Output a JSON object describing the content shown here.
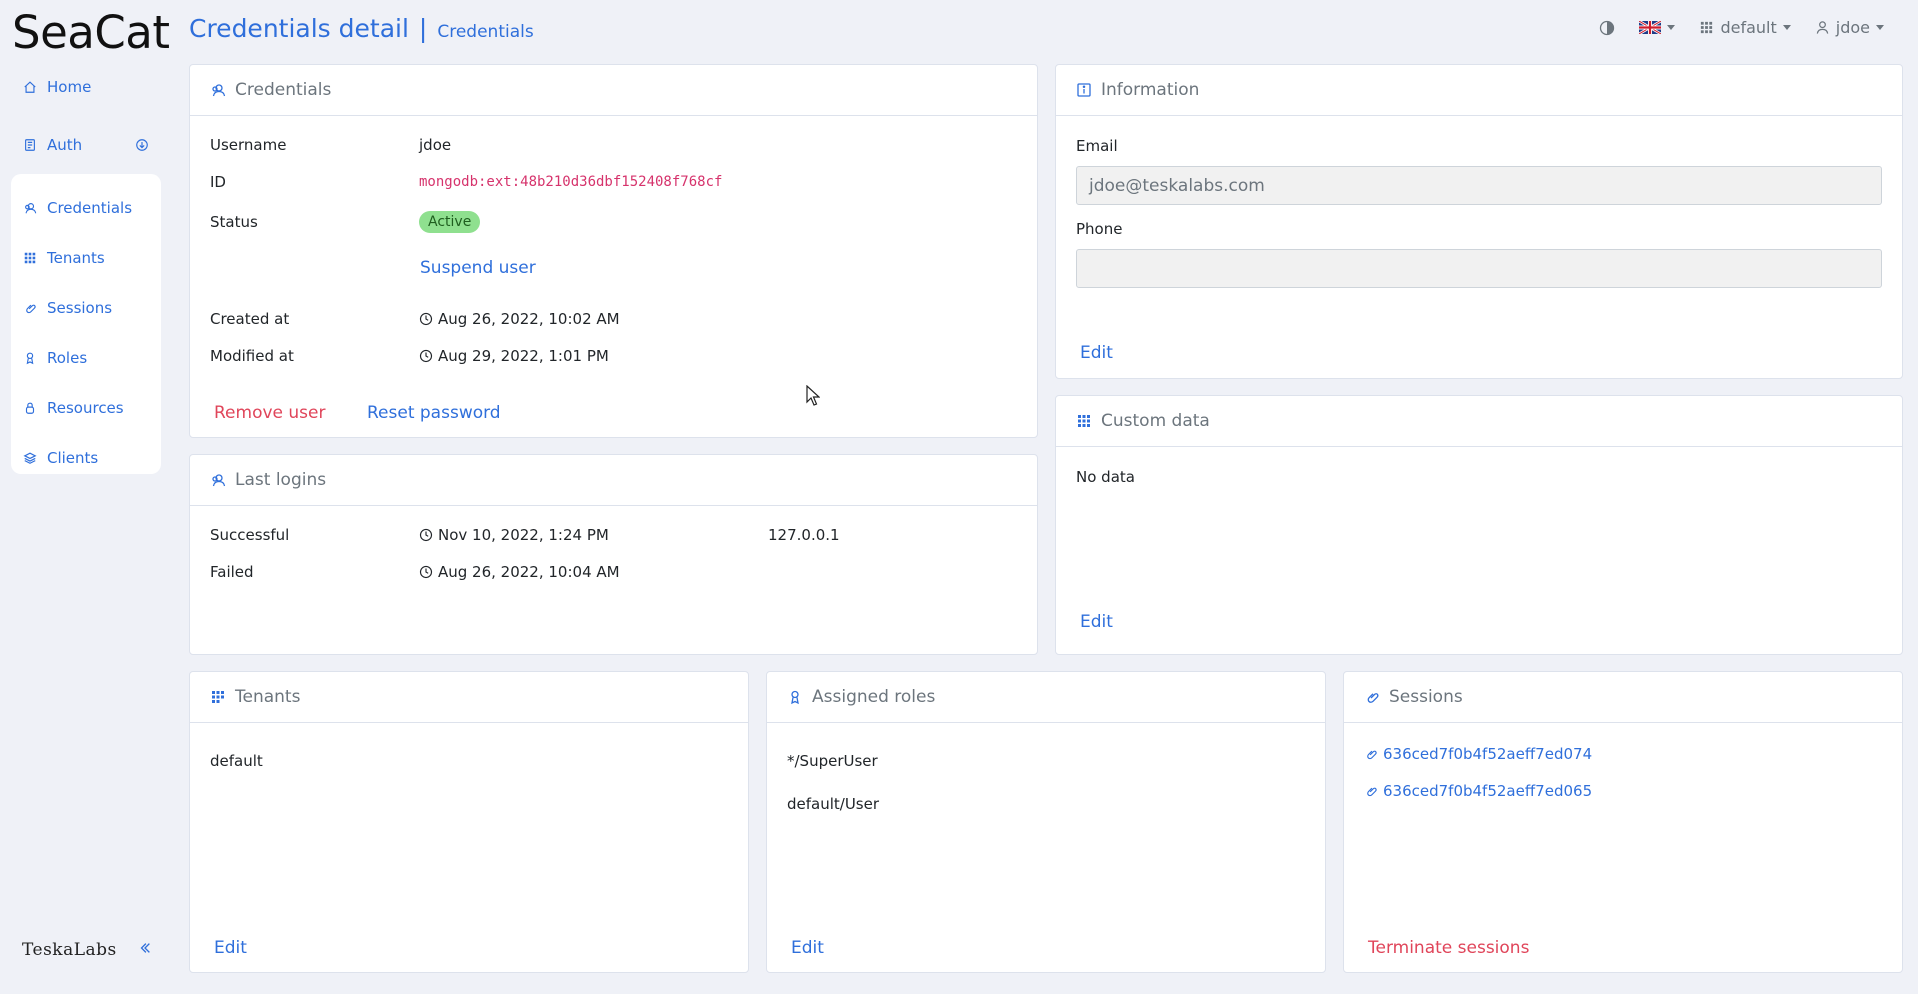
{
  "app": {
    "brand": "SeaCat"
  },
  "header": {
    "title": "Credentials detail",
    "separator": "|",
    "subtitle": "Credentials",
    "tenant": "default",
    "user": "jdoe"
  },
  "sidebar": {
    "top_items": [
      {
        "label": "Home",
        "icon": "home-icon"
      },
      {
        "label": "Auth",
        "icon": "auth-icon"
      }
    ],
    "group_items": [
      {
        "label": "Credentials",
        "icon": "credentials-icon"
      },
      {
        "label": "Tenants",
        "icon": "tenants-icon"
      },
      {
        "label": "Sessions",
        "icon": "sessions-icon"
      },
      {
        "label": "Roles",
        "icon": "roles-icon"
      },
      {
        "label": "Resources",
        "icon": "resources-icon"
      },
      {
        "label": "Clients",
        "icon": "clients-icon"
      }
    ],
    "footer_logo": "TeskaLabs"
  },
  "credentials_card": {
    "title": "Credentials",
    "username_label": "Username",
    "username": "jdoe",
    "id_label": "ID",
    "id": "mongodb:ext:48b210d36dbf152408f768cf",
    "status_label": "Status",
    "status": "Active",
    "suspend": "Suspend user",
    "created_label": "Created at",
    "created": "Aug 26, 2022, 10:02 AM",
    "modified_label": "Modified at",
    "modified": "Aug 29, 2022, 1:01 PM",
    "remove": "Remove user",
    "reset": "Reset password"
  },
  "information_card": {
    "title": "Information",
    "email_label": "Email",
    "email": "jdoe@teskalabs.com",
    "phone_label": "Phone",
    "phone": "",
    "edit": "Edit"
  },
  "last_logins_card": {
    "title": "Last logins",
    "successful_label": "Successful",
    "successful_time": "Nov 10, 2022, 1:24 PM",
    "successful_ip": "127.0.0.1",
    "failed_label": "Failed",
    "failed_time": "Aug 26, 2022, 10:04 AM"
  },
  "custom_data_card": {
    "title": "Custom data",
    "empty": "No data",
    "edit": "Edit"
  },
  "tenants_card": {
    "title": "Tenants",
    "items": [
      "default"
    ],
    "edit": "Edit"
  },
  "roles_card": {
    "title": "Assigned roles",
    "items": [
      "*/SuperUser",
      "default/User"
    ],
    "edit": "Edit"
  },
  "sessions_card": {
    "title": "Sessions",
    "items": [
      "636ced7f0b4f52aeff7ed074",
      "636ced7f0b4f52aeff7ed065"
    ],
    "terminate": "Terminate sessions"
  }
}
